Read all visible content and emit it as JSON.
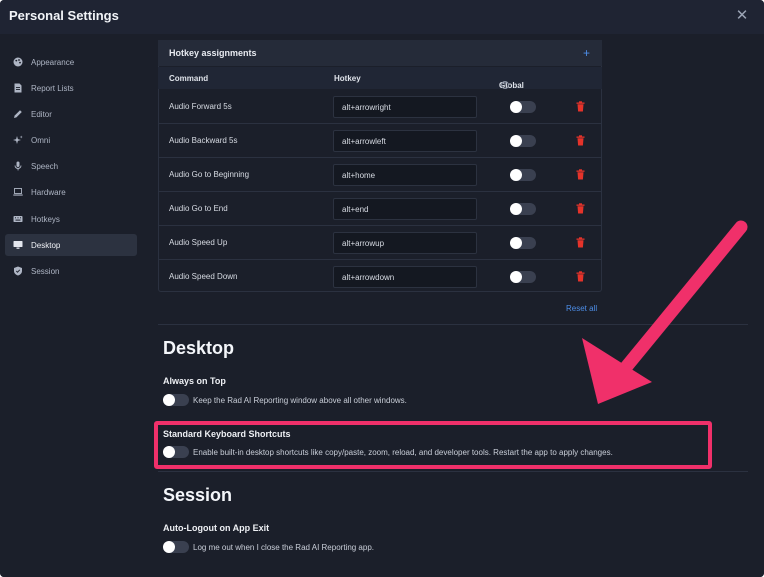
{
  "window": {
    "title": "Personal Settings",
    "close_icon": "close-icon"
  },
  "sidebar": {
    "items": [
      {
        "label": "Appearance",
        "icon": "palette-icon"
      },
      {
        "label": "Report Lists",
        "icon": "document-icon"
      },
      {
        "label": "Editor",
        "icon": "pencil-icon"
      },
      {
        "label": "Omni",
        "icon": "sparkle-icon"
      },
      {
        "label": "Speech",
        "icon": "microphone-icon"
      },
      {
        "label": "Hardware",
        "icon": "laptop-icon"
      },
      {
        "label": "Hotkeys",
        "icon": "keyboard-icon"
      },
      {
        "label": "Desktop",
        "icon": "monitor-icon",
        "active": true
      },
      {
        "label": "Session",
        "icon": "shield-icon"
      }
    ]
  },
  "hotkeys": {
    "title": "Hotkey assignments",
    "add_label": "+",
    "columns": {
      "command": "Command",
      "hotkey": "Hotkey",
      "global": "Global",
      "global_info": "?"
    },
    "rows": [
      {
        "command": "Audio Forward 5s",
        "hotkey": "alt+arrowright",
        "global": false
      },
      {
        "command": "Audio Backward 5s",
        "hotkey": "alt+arrowleft",
        "global": false
      },
      {
        "command": "Audio Go to Beginning",
        "hotkey": "alt+home",
        "global": false
      },
      {
        "command": "Audio Go to End",
        "hotkey": "alt+end",
        "global": false
      },
      {
        "command": "Audio Speed Up",
        "hotkey": "alt+arrowup",
        "global": false
      },
      {
        "command": "Audio Speed Down",
        "hotkey": "alt+arrowdown",
        "global": false
      }
    ],
    "reset_label": "Reset all"
  },
  "desktop": {
    "heading": "Desktop",
    "always_on_top": {
      "title": "Always on Top",
      "description": "Keep the Rad AI Reporting window above all other windows.",
      "enabled": false
    },
    "standard_shortcuts": {
      "title": "Standard Keyboard Shortcuts",
      "description": "Enable built-in desktop shortcuts like copy/paste, zoom, reload, and developer tools. Restart the app to apply changes.",
      "enabled": false
    }
  },
  "session": {
    "heading": "Session",
    "auto_logout": {
      "title": "Auto-Logout on App Exit",
      "description": "Log me out when I close the Rad AI Reporting app.",
      "enabled": false
    }
  },
  "colors": {
    "accent": "#4d8ee8",
    "delete": "#e5332a",
    "annotation": "#f0306a",
    "background": "#1b1f2a"
  }
}
